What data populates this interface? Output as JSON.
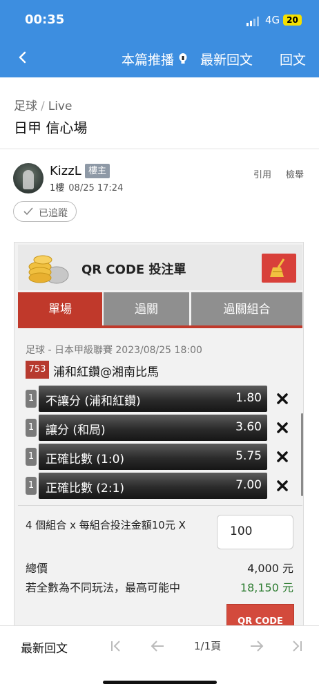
{
  "status": {
    "time": "00:35",
    "network": "4G",
    "battery": "20"
  },
  "nav": {
    "push_label": "本篇推播",
    "latest_label": "最新回文",
    "reply_label": "回文"
  },
  "breadcrumb": {
    "category": "足球",
    "separator": "/",
    "sub": "Live"
  },
  "post_title": "日甲 信心場",
  "author": {
    "name": "KizzL",
    "badge": "樓主",
    "floor": "1樓",
    "datetime": "08/25 17:24",
    "quote_label": "引用",
    "report_label": "檢舉",
    "follow_label": "已追蹤"
  },
  "qr": {
    "title": "QR CODE 投注單",
    "tabs": [
      {
        "label": "單場"
      },
      {
        "label": "過關"
      },
      {
        "label": "過關組合"
      }
    ],
    "league_line": "足球 - 日本甲級聯賽 2023/08/25 18:00",
    "match_no": "753",
    "match_name": "浦和紅鑽@湘南比馬",
    "bets": [
      {
        "count": "1",
        "name": "不讓分 (浦和紅鑽)",
        "odds": "1.80"
      },
      {
        "count": "1",
        "name": "讓分 (和局)",
        "odds": "3.60"
      },
      {
        "count": "1",
        "name": "正確比數 (1:0)",
        "odds": "5.75"
      },
      {
        "count": "1",
        "name": "正確比數 (2:1)",
        "odds": "7.00"
      }
    ],
    "combo_text": "4 個組合 x 每組合投注金額10元 X",
    "amount_value": "100",
    "total_label": "總價",
    "total_value": "4,000 元",
    "max_win_label": "若全數為不同玩法，最高可能中",
    "max_win_value": "18,150 元",
    "button_label": "QR CODE",
    "colors": {
      "accent": "#c0392b",
      "win": "#2e7d32"
    }
  },
  "bottom": {
    "latest_label": "最新回文",
    "page_label": "1/1頁"
  }
}
